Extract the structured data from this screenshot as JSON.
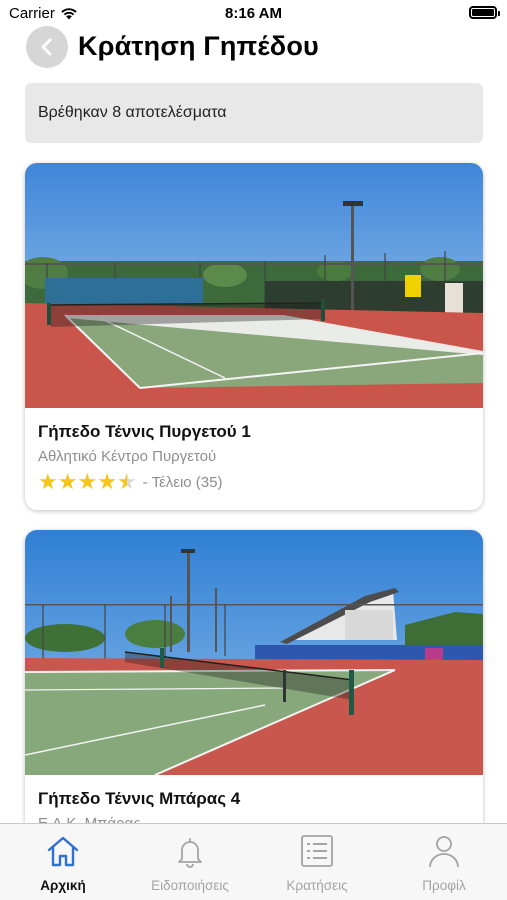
{
  "status_bar": {
    "carrier": "Carrier",
    "time": "8:16 AM"
  },
  "header": {
    "title": "Κράτηση Γηπέδου",
    "back_icon": "chevron-left-icon"
  },
  "results": {
    "text": "Βρέθηκαν 8 αποτελέσματα"
  },
  "courts": [
    {
      "name": "Γήπεδο Τέννις Πυργετού 1",
      "venue": "Αθλητικό Κέντρο Πυργετού",
      "rating_stars": 4.5,
      "rating_text": "- Τέλειο (35)"
    },
    {
      "name": "Γήπεδο Τέννις Μπάρας 4",
      "venue": "Ε.Α.Κ. Μπάρας"
    }
  ],
  "tab_bar": {
    "items": [
      {
        "label": "Αρχική",
        "icon": "home-icon",
        "active": true
      },
      {
        "label": "Ειδοποιήσεις",
        "icon": "bell-icon",
        "active": false
      },
      {
        "label": "Κρατήσεις",
        "icon": "list-icon",
        "active": false
      },
      {
        "label": "Προφίλ",
        "icon": "profile-icon",
        "active": false
      }
    ]
  },
  "colors": {
    "accent": "#2f6fd6",
    "star": "#f5c518",
    "inactive": "#a3a3a3"
  }
}
